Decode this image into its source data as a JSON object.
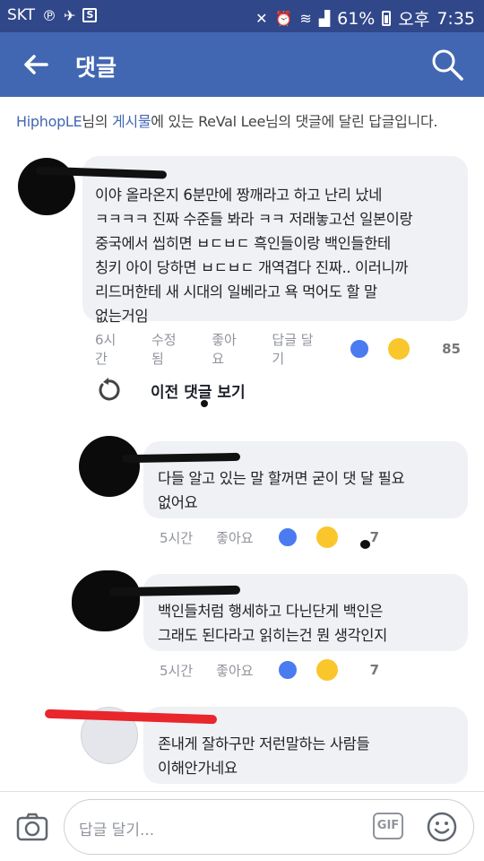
{
  "status_bar": {
    "carrier": "SKT",
    "battery": "61%",
    "ampm": "오후",
    "time": "7:35"
  },
  "header": {
    "title": "댓글"
  },
  "context": {
    "user": "HiphopLE",
    "suffix1": "님의 ",
    "link": "게시물",
    "suffix2": "에 있는 ReVal Lee님의 댓글에 달린 답글입니다."
  },
  "parent_comment": {
    "text": "이야 올라온지 6분만에 짱깨라고 하고 난리 났네\nㅋㅋㅋㅋ 진짜 수준들 봐라 ㅋㅋ 저래놓고선 일본이랑\n중국에서 씹히면 ㅂㄷㅂㄷ 흑인들이랑 백인들한테\n칭키 아이 당하면 ㅂㄷㅂㄷ 개역겹다 진짜.. 이러니까\n리드머한테 새 시대의 일베라고 욕 먹어도 할 말\n없는거임",
    "time": "6시간",
    "edited": "수정됨",
    "like": "좋아요",
    "reply": "답글 달기",
    "reaction_count": "85"
  },
  "previous_replies": {
    "label": "이전 댓글 보기"
  },
  "replies": [
    {
      "text": "다들 알고 있는 말 할꺼면 굳이 댓 달 필요\n없어요",
      "time": "5시간",
      "like": "좋아요",
      "reaction_count": "7"
    },
    {
      "text": "백인들처럼 행세하고 다닌단게 백인은\n그래도 된다라고 읽히는건 뭔 생각인지",
      "time": "5시간",
      "like": "좋아요",
      "reaction_count": "7"
    },
    {
      "text": "존내게 잘하구만 저런말하는 사람들\n이해안가네요"
    }
  ],
  "composer": {
    "placeholder": "답글 달기...",
    "gif_label": "GIF"
  },
  "colors": {
    "status_bar": "#30478a",
    "app_bar": "#4267b2",
    "bubble": "#f0f1f5",
    "link": "#4267b2",
    "meta": "#90949c"
  },
  "icons": [
    "back-arrow-icon",
    "search-icon",
    "refresh-icon",
    "like-reaction-icon",
    "haha-reaction-icon",
    "camera-icon",
    "gif-icon",
    "smiley-icon"
  ]
}
